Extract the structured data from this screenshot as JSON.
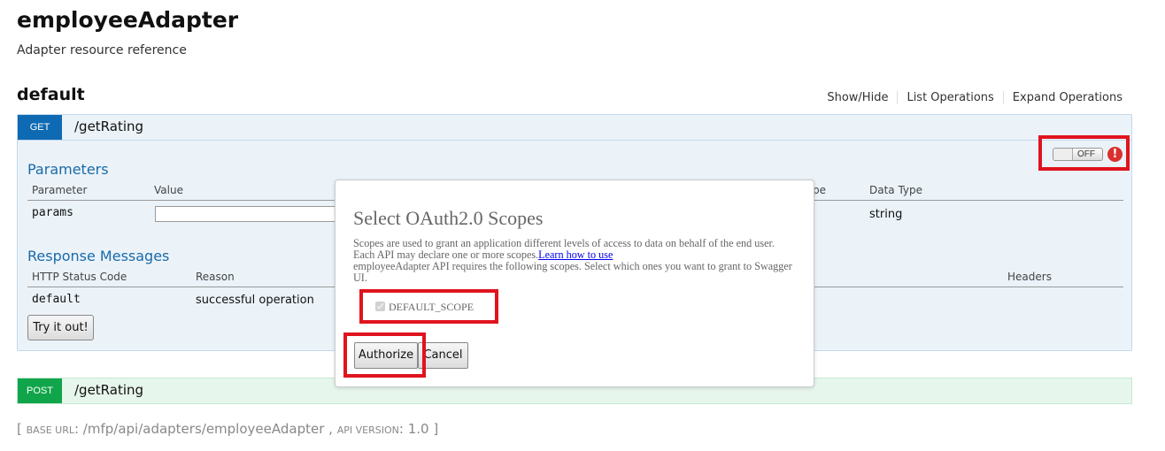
{
  "header": {
    "title": "employeeAdapter",
    "subtitle": "Adapter resource reference"
  },
  "section": {
    "name": "default",
    "ops": [
      "Show/Hide",
      "List Operations",
      "Expand Operations"
    ]
  },
  "get_endpoint": {
    "method": "GET",
    "path": "/getRating",
    "toggle": "OFF",
    "alert_icon": "!",
    "parameters": {
      "heading": "Parameters",
      "headers": [
        "Parameter",
        "Value",
        "pe",
        "Data Type"
      ],
      "row": {
        "name": "params",
        "data_type": "string"
      }
    },
    "responses": {
      "heading": "Response Messages",
      "headers": [
        "HTTP Status Code",
        "Reason",
        "Headers"
      ],
      "row": {
        "code": "default",
        "reason": "successful operation"
      }
    },
    "try_button": "Try it out!"
  },
  "post_endpoint": {
    "method": "POST",
    "path": "/getRating"
  },
  "footer": {
    "open": "[",
    "base_url_label": "base url",
    "base_url": "/mfp/api/adapters/employeeAdapter",
    "sep": ",",
    "api_version_label": "api version",
    "api_version": "1.0",
    "close": "]"
  },
  "modal": {
    "title": "Select OAuth2.0 Scopes",
    "desc1": "Scopes are used to grant an application different levels of access to data on behalf of the end user. Each API may declare one or more scopes.",
    "learn_link": "Learn how to use",
    "desc2": "employeeAdapter API requires the following scopes. Select which ones you want to grant to Swagger UI.",
    "scope": "DEFAULT_SCOPE",
    "authorize_button": "Authorize",
    "cancel_button": "Cancel"
  },
  "colors": {
    "get": "#0f6ab4",
    "post": "#10a54a",
    "highlight": "#e0141e",
    "alert": "#d9302d"
  }
}
